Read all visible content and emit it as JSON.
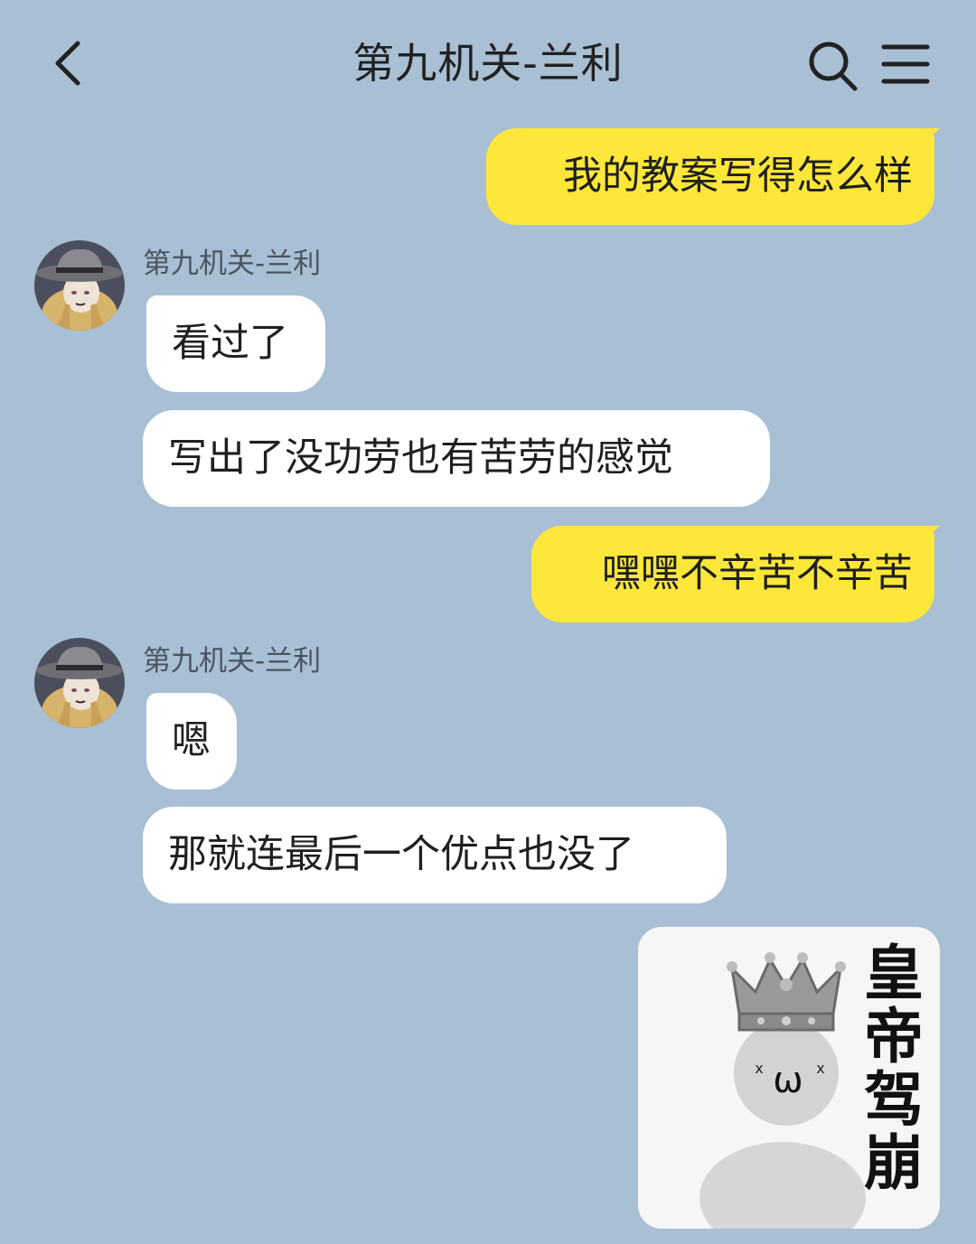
{
  "header": {
    "title": "第九机关-兰利",
    "back_icon": "chevron-left-icon",
    "search_icon": "search-icon",
    "menu_icon": "menu-icon"
  },
  "colors": {
    "background": "#a9bfd3",
    "outgoing_bubble": "#fde73a",
    "incoming_bubble": "#ffffff"
  },
  "messages": [
    {
      "direction": "out",
      "text": "我的教案写得怎么样"
    },
    {
      "direction": "in",
      "sender": "第九机关-兰利",
      "text": "看过了"
    },
    {
      "direction": "in",
      "text": "写出了没功劳也有苦劳的感觉"
    },
    {
      "direction": "out",
      "text": "嘿嘿不辛苦不辛苦"
    },
    {
      "direction": "in",
      "sender": "第九机关-兰利",
      "text": "嗯"
    },
    {
      "direction": "in",
      "text": "那就连最后一个优点也没了"
    },
    {
      "direction": "out",
      "type": "sticker",
      "text": "皇帝驾崩",
      "face": "ω"
    }
  ]
}
